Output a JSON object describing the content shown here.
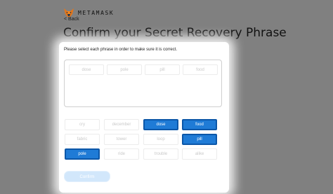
{
  "brand": {
    "name": "METAMASK",
    "logo_icon": "metamask-fox-icon"
  },
  "nav": {
    "back_label": "< Back"
  },
  "page": {
    "title": "Confirm your Secret Recovery Phrase",
    "instruction": "Please select each phrase in order to make sure it is correct."
  },
  "selected_words": [
    "dose",
    "pole",
    "pill",
    "food"
  ],
  "word_bank": [
    {
      "word": "cry",
      "selected": false
    },
    {
      "word": "december",
      "selected": false
    },
    {
      "word": "dose",
      "selected": true
    },
    {
      "word": "food",
      "selected": true
    },
    {
      "word": "fabric",
      "selected": false
    },
    {
      "word": "tower",
      "selected": false
    },
    {
      "word": "loop",
      "selected": false
    },
    {
      "word": "pill",
      "selected": true
    },
    {
      "word": "pole",
      "selected": true
    },
    {
      "word": "ride",
      "selected": false
    },
    {
      "word": "trouble",
      "selected": false
    },
    {
      "word": "alike",
      "selected": false
    }
  ],
  "confirm_button": {
    "label": "Confirm",
    "disabled": true
  },
  "colors": {
    "accent": "#1f7bd6",
    "accent_border": "#0c57a8",
    "backdrop": "#808080"
  }
}
